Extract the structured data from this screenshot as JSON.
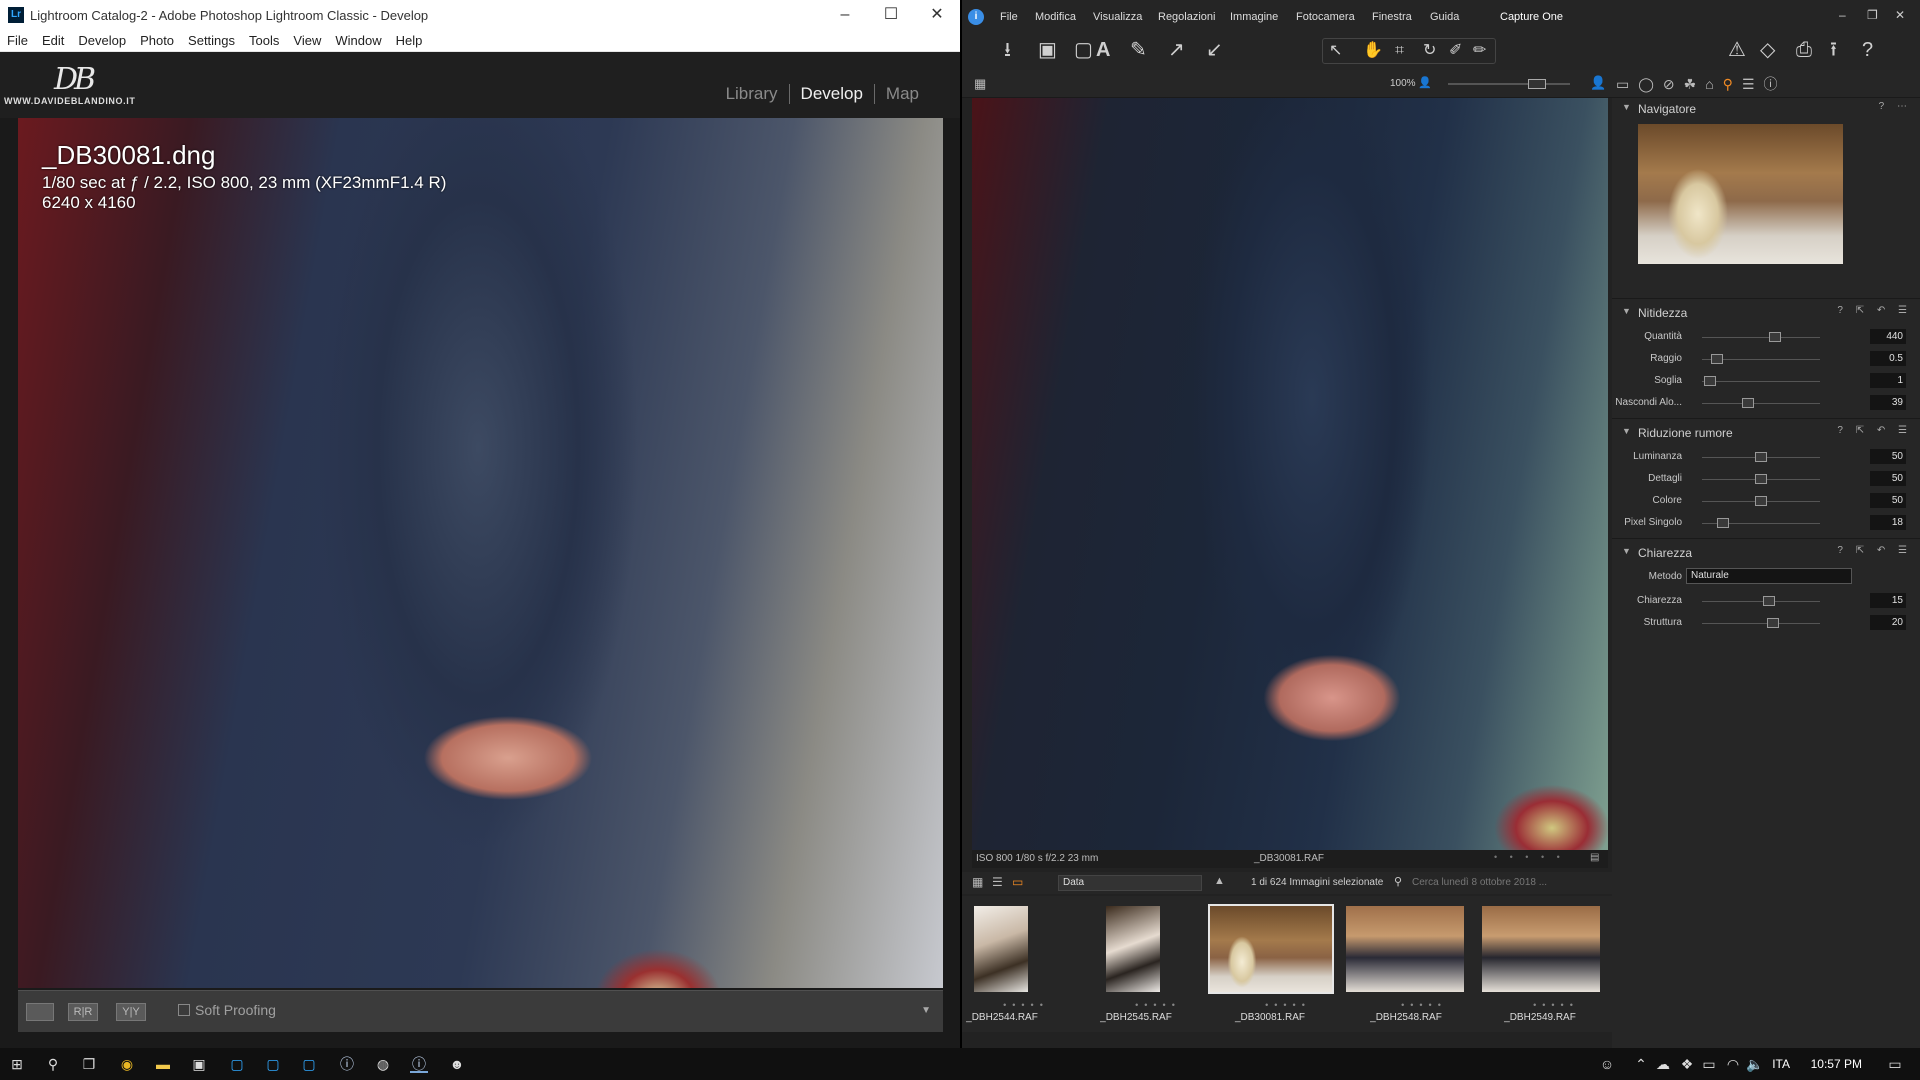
{
  "lightroom": {
    "window_title": "Lightroom Catalog-2 - Adobe Photoshop Lightroom Classic - Develop",
    "app_icon": "Lr",
    "menu": [
      "File",
      "Edit",
      "Develop",
      "Photo",
      "Settings",
      "Tools",
      "View",
      "Window",
      "Help"
    ],
    "logo_text": "DB",
    "logo_site": "WWW.DAVIDEBLANDINO.IT",
    "modules": [
      "Library",
      "Develop",
      "Map"
    ],
    "active_module": "Develop",
    "photo_info": {
      "filename": "_DB30081.dng",
      "exposure": "1/80 sec at ƒ / 2.2, ISO 800, 23 mm (XF23mmF1.4 R)",
      "dimensions": "6240 x 4160"
    },
    "toolbar": {
      "view_loupe_icon": "loupe-view-icon",
      "before_after_label": "R|R",
      "yy_label": "Y|Y",
      "soft_proofing_label": "Soft Proofing"
    },
    "window_controls": {
      "minimize": "–",
      "maximize": "☐",
      "close": "✕"
    }
  },
  "captureone": {
    "menu": [
      "File",
      "Modifica",
      "Visualizza",
      "Regolazioni",
      "Immagine",
      "Fotocamera",
      "Finestra",
      "Guida"
    ],
    "app_name": "Capture One",
    "zoom_label": "100%",
    "status_left": "ISO 800  1/80 s  f/2.2  23 mm",
    "status_filename": "_DB30081.RAF",
    "sort_value": "Data",
    "selection_count": "1 di 624 Immagini selezionate",
    "search_placeholder": "Cerca lunedì 8 ottobre 2018 ...",
    "thumbnails": [
      {
        "name": "_DBH2544.RAF",
        "selected": false
      },
      {
        "name": "_DBH2545.RAF",
        "selected": false
      },
      {
        "name": "_DB30081.RAF",
        "selected": true
      },
      {
        "name": "_DBH2548.RAF",
        "selected": false
      },
      {
        "name": "_DBH2549.RAF",
        "selected": false
      }
    ],
    "panel": {
      "navigator": {
        "title": "Navigatore"
      },
      "sharpening": {
        "title": "Nitidezza",
        "rows": [
          {
            "label": "Quantità",
            "value": "440",
            "level": 0.62
          },
          {
            "label": "Raggio",
            "value": "0.5",
            "level": 0.13
          },
          {
            "label": "Soglia",
            "value": "1",
            "level": 0.07
          },
          {
            "label": "Nascondi Alo...",
            "value": "39",
            "level": 0.39
          }
        ]
      },
      "noise": {
        "title": "Riduzione rumore",
        "rows": [
          {
            "label": "Luminanza",
            "value": "50",
            "level": 0.5
          },
          {
            "label": "Dettagli",
            "value": "50",
            "level": 0.5
          },
          {
            "label": "Colore",
            "value": "50",
            "level": 0.5
          },
          {
            "label": "Pixel Singolo",
            "value": "18",
            "level": 0.18
          }
        ]
      },
      "clarity": {
        "title": "Chiarezza",
        "method_label": "Metodo",
        "method_value": "Naturale",
        "rows": [
          {
            "label": "Chiarezza",
            "value": "15",
            "level": 0.57
          },
          {
            "label": "Struttura",
            "value": "20",
            "level": 0.6
          }
        ]
      }
    }
  },
  "taskbar": {
    "language": "ITA",
    "time": "10:57 PM"
  }
}
